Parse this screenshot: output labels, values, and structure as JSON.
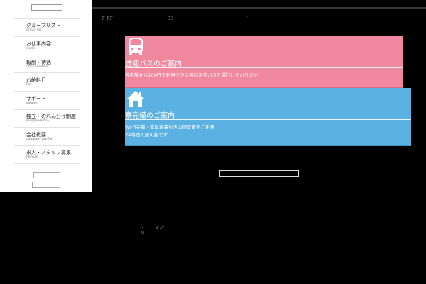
{
  "header": {
    "nav_text_1": "ﾌﾟﾗﾌﾞ",
    "nav_text_2": "ｺｺ",
    "nav_text_3": "·"
  },
  "sidebar": {
    "items": [
      {
        "label": "グループリスト",
        "sub": "group list"
      },
      {
        "label": "お仕事内容",
        "sub": "works"
      },
      {
        "label": "報酬・待遇",
        "sub": "remuneration"
      },
      {
        "label": "お給料日",
        "sub": "Pay"
      },
      {
        "label": "サポート",
        "sub": "support"
      },
      {
        "label": "独立・のれん分け制度",
        "sub": "independence"
      },
      {
        "label": "会社概要",
        "sub": "company profile"
      },
      {
        "label": "求人・スタッフ募集",
        "sub": "Recruit"
      }
    ]
  },
  "cards": [
    {
      "title": "送迎バスのご案内",
      "lines": [
        "各店舗から100円で利用できる無料送迎バスを運行しております"
      ],
      "icon": "bus-icon",
      "color": "#f088a0"
    },
    {
      "title": "寮完備のご案内",
      "lines": [
        "Wi-Fi完備・家具家電付きの個室寮をご用意",
        "24時間入居可能です"
      ],
      "icon": "house-icon",
      "color": "#5bb1e2"
    }
  ],
  "pager": {
    "prev": "‹",
    "current": "ﾍﾟｰｼﾞ",
    "number": "ｺｺ"
  }
}
